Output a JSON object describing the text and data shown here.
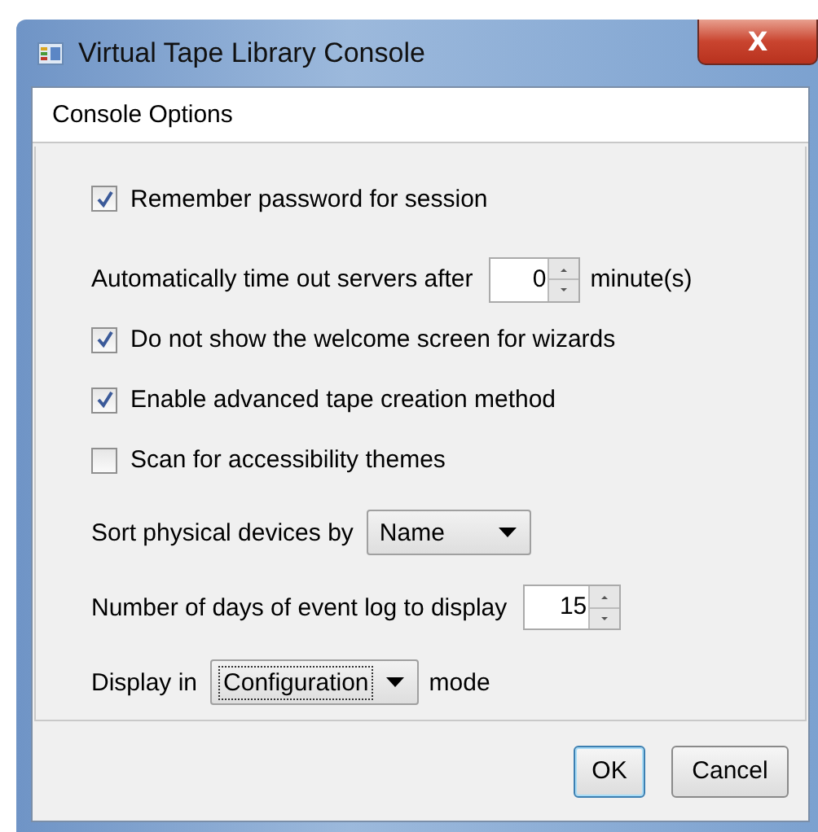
{
  "window": {
    "title": "Virtual Tape Library Console",
    "close": "X"
  },
  "panel": {
    "title": "Console Options"
  },
  "options": [
    {
      "kind": "checkbox",
      "label": "Remember password for session",
      "checked": true
    },
    {
      "kind": "spinner",
      "label": "Automatically time out servers after",
      "value": "0",
      "suffix": "minute(s)"
    },
    {
      "kind": "checkbox",
      "label": "Do not show the welcome screen for wizards",
      "checked": true
    },
    {
      "kind": "checkbox",
      "label": "Enable advanced tape creation method",
      "checked": true
    },
    {
      "kind": "checkbox",
      "label": "Scan for accessibility themes",
      "checked": false
    },
    {
      "kind": "select",
      "label": "Sort physical devices by",
      "value": "Name",
      "focused": false
    },
    {
      "kind": "spinner",
      "label": "Number of days of event log to display",
      "value": "15"
    },
    {
      "kind": "select",
      "label": "Display in",
      "value": "Configuration",
      "suffix": "mode",
      "focused": true
    }
  ],
  "buttons": [
    {
      "label": "OK",
      "default": true
    },
    {
      "label": "Cancel",
      "default": false
    }
  ]
}
